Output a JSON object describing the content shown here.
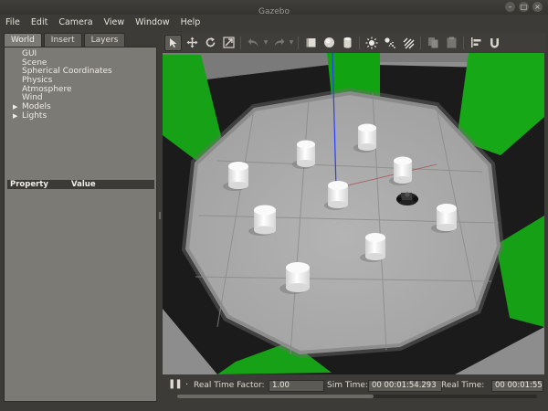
{
  "window": {
    "title": "Gazebo",
    "buttons": [
      "close-icon",
      "minimize-icon",
      "maximize-icon"
    ]
  },
  "menubar": {
    "items": [
      "File",
      "Edit",
      "Camera",
      "View",
      "Window",
      "Help"
    ]
  },
  "left_panel": {
    "tabs": [
      "World",
      "Insert",
      "Layers"
    ],
    "active_tab": "World",
    "tree": [
      {
        "label": "GUI",
        "expandable": false
      },
      {
        "label": "Scene",
        "expandable": false
      },
      {
        "label": "Spherical Coordinates",
        "expandable": false
      },
      {
        "label": "Physics",
        "expandable": false
      },
      {
        "label": "Atmosphere",
        "expandable": false
      },
      {
        "label": "Wind",
        "expandable": false
      },
      {
        "label": "Models",
        "expandable": true
      },
      {
        "label": "Lights",
        "expandable": true
      }
    ],
    "property_table": {
      "col_property": "Property",
      "col_value": "Value"
    }
  },
  "toolbar": {
    "tools": [
      "select-arrow-icon",
      "translate-icon",
      "rotate-icon",
      "scale-icon",
      "undo-icon",
      "redo-icon",
      "box-icon",
      "sphere-icon",
      "cylinder-icon",
      "point-light-icon",
      "spot-light-icon",
      "directional-light-icon",
      "copy-icon",
      "paste-icon",
      "align-icon",
      "snap-icon"
    ]
  },
  "bottom_bar": {
    "real_time_factor_label": "Real Time Factor:",
    "real_time_factor": "1.00",
    "sim_time_label": "Sim Time:",
    "sim_time": "00 00:01:54.293",
    "real_time_label": "Real Time:",
    "real_time": "00 00:01:55.",
    "step_dot": "."
  },
  "colors": {
    "background": "#3c3b37",
    "panel": "#7b7a75",
    "floor": "#a9a9a9",
    "wall": "#1c1c1c",
    "green_accent": "#16a116",
    "axis_z": "#1f3fff",
    "axis_x": "#b03030"
  }
}
